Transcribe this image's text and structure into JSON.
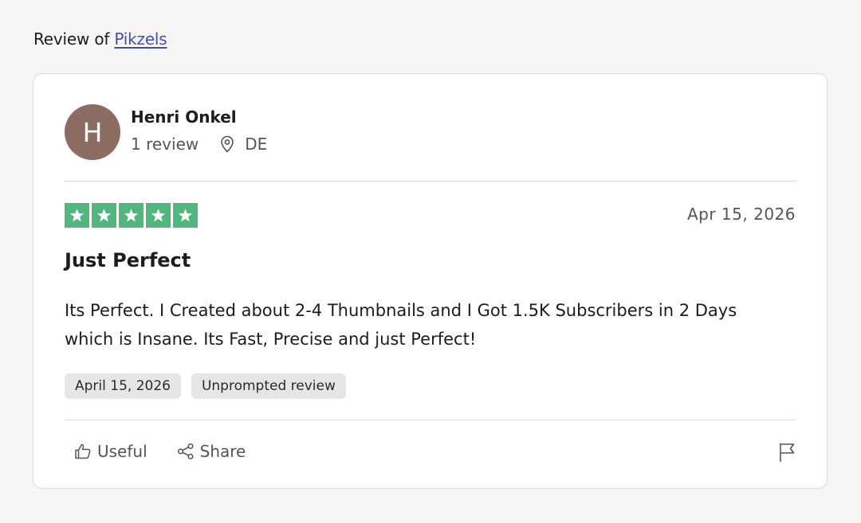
{
  "header": {
    "prefix": "Review of ",
    "company_link": "Pikzels"
  },
  "reviewer": {
    "initial": "H",
    "name": "Henri Onkel",
    "review_count": "1 review",
    "country": "DE",
    "avatar_color": "#8c6b62"
  },
  "review": {
    "rating": 5,
    "date": "Apr 15, 2026",
    "title": "Just Perfect",
    "text": "Its Perfect. I Created about 2-4 Thumbnails and I Got 1.5K Subscribers in 2 Days which is Insane. Its Fast, Precise and just Perfect!",
    "tags": [
      "April 15, 2026",
      "Unprompted review"
    ],
    "star_color": "#52b77e"
  },
  "actions": {
    "useful_label": "Useful",
    "useful_icon": "thumbs-up-icon",
    "share_label": "Share",
    "share_icon": "share-icon",
    "report_icon": "flag-icon"
  }
}
